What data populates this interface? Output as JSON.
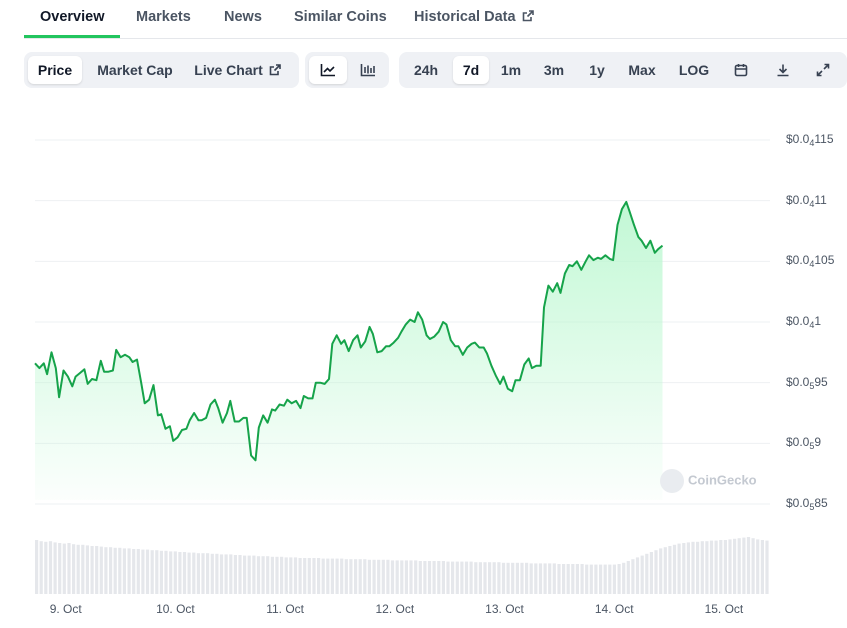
{
  "tabs": [
    {
      "label": "Overview",
      "active": true
    },
    {
      "label": "Markets"
    },
    {
      "label": "News"
    },
    {
      "label": "Similar Coins"
    },
    {
      "label": "Historical Data",
      "icon": "external-link-icon"
    }
  ],
  "toolbar": {
    "metric": {
      "items": [
        "Price",
        "Market Cap",
        "Live Chart"
      ],
      "selected": "Price",
      "live_icon": "external-link-icon"
    },
    "chart_kind": {
      "icons": [
        "line-chart-icon",
        "candlestick-icon"
      ],
      "selected": "line-chart-icon"
    },
    "range": {
      "items": [
        "24h",
        "7d",
        "1m",
        "3m",
        "1y",
        "Max",
        "LOG"
      ],
      "selected": "7d"
    },
    "actions": {
      "icons": [
        "calendar-icon",
        "download-icon",
        "expand-icon"
      ]
    }
  },
  "watermark": "CoinGecko",
  "colors": {
    "line": "#16a34a",
    "fill_top": "#bbf7d0",
    "accent": "#22c55e",
    "volume": "#e5e7eb"
  },
  "chart_data": {
    "type": "area",
    "x_ticks": [
      "9. Oct",
      "10. Oct",
      "11. Oct",
      "12. Oct",
      "13. Oct",
      "14. Oct",
      "15. Oct"
    ],
    "y_ticks": [
      {
        "prefix": "$0.0",
        "sub": "4",
        "suffix": "115"
      },
      {
        "prefix": "$0.0",
        "sub": "4",
        "suffix": "11"
      },
      {
        "prefix": "$0.0",
        "sub": "4",
        "suffix": "105"
      },
      {
        "prefix": "$0.0",
        "sub": "4",
        "suffix": "1"
      },
      {
        "prefix": "$0.0",
        "sub": "5",
        "suffix": "95"
      },
      {
        "prefix": "$0.0",
        "sub": "5",
        "suffix": "9"
      },
      {
        "prefix": "$0.0",
        "sub": "5",
        "suffix": "85"
      }
    ],
    "y_tick_values": [
      1.15e-05,
      1.1e-05,
      1.05e-05,
      1e-05,
      9.5e-06,
      9e-06,
      8.5e-06
    ],
    "y_range": [
      8.5e-06,
      1.15e-05
    ],
    "x_range": [
      8.72,
      15.42
    ],
    "grid": true,
    "legend": "none",
    "price": [
      [
        8.72,
        9.66e-06
      ],
      [
        8.76,
        9.62e-06
      ],
      [
        8.8,
        9.66e-06
      ],
      [
        8.83,
        9.57e-06
      ],
      [
        8.87,
        9.75e-06
      ],
      [
        8.91,
        9.62e-06
      ],
      [
        8.94,
        9.38e-06
      ],
      [
        8.98,
        9.6e-06
      ],
      [
        9.02,
        9.55e-06
      ],
      [
        9.06,
        9.47e-06
      ],
      [
        9.09,
        9.55e-06
      ],
      [
        9.13,
        9.58e-06
      ],
      [
        9.17,
        9.61e-06
      ],
      [
        9.2,
        9.49e-06
      ],
      [
        9.24,
        9.53e-06
      ],
      [
        9.28,
        9.52e-06
      ],
      [
        9.32,
        9.68e-06
      ],
      [
        9.35,
        9.59e-06
      ],
      [
        9.39,
        9.59e-06
      ],
      [
        9.43,
        9.6e-06
      ],
      [
        9.46,
        9.77e-06
      ],
      [
        9.5,
        9.71e-06
      ],
      [
        9.54,
        9.73e-06
      ],
      [
        9.58,
        9.71e-06
      ],
      [
        9.61,
        9.67e-06
      ],
      [
        9.65,
        9.69e-06
      ],
      [
        9.69,
        9.49e-06
      ],
      [
        9.72,
        9.33e-06
      ],
      [
        9.76,
        9.36e-06
      ],
      [
        9.8,
        9.48e-06
      ],
      [
        9.84,
        9.23e-06
      ],
      [
        9.87,
        9.24e-06
      ],
      [
        9.91,
        9.12e-06
      ],
      [
        9.95,
        9.14e-06
      ],
      [
        9.98,
        9.02e-06
      ],
      [
        10.02,
        9.05e-06
      ],
      [
        10.06,
        9.11e-06
      ],
      [
        10.1,
        9.12e-06
      ],
      [
        10.13,
        9.19e-06
      ],
      [
        10.17,
        9.25e-06
      ],
      [
        10.21,
        9.19e-06
      ],
      [
        10.24,
        9.19e-06
      ],
      [
        10.28,
        9.21e-06
      ],
      [
        10.32,
        9.32e-06
      ],
      [
        10.36,
        9.36e-06
      ],
      [
        10.39,
        9.29e-06
      ],
      [
        10.43,
        9.17e-06
      ],
      [
        10.47,
        9.25e-06
      ],
      [
        10.5,
        9.35e-06
      ],
      [
        10.54,
        9.18e-06
      ],
      [
        10.58,
        9.18e-06
      ],
      [
        10.62,
        9.21e-06
      ],
      [
        10.65,
        9.21e-06
      ],
      [
        10.69,
        8.9e-06
      ],
      [
        10.73,
        8.86e-06
      ],
      [
        10.76,
        9.13e-06
      ],
      [
        10.8,
        9.23e-06
      ],
      [
        10.84,
        9.17e-06
      ],
      [
        10.88,
        9.28e-06
      ],
      [
        10.91,
        9.27e-06
      ],
      [
        10.95,
        9.32e-06
      ],
      [
        10.99,
        9.31e-06
      ],
      [
        11.02,
        9.36e-06
      ],
      [
        11.06,
        9.33e-06
      ],
      [
        11.1,
        9.35e-06
      ],
      [
        11.14,
        9.29e-06
      ],
      [
        11.17,
        9.39e-06
      ],
      [
        11.21,
        9.37e-06
      ],
      [
        11.25,
        9.37e-06
      ],
      [
        11.28,
        9.5e-06
      ],
      [
        11.32,
        9.5e-06
      ],
      [
        11.36,
        9.49e-06
      ],
      [
        11.4,
        9.53e-06
      ],
      [
        11.43,
        9.82e-06
      ],
      [
        11.47,
        9.89e-06
      ],
      [
        11.51,
        9.82e-06
      ],
      [
        11.54,
        9.85e-06
      ],
      [
        11.58,
        9.76e-06
      ],
      [
        11.62,
        9.85e-06
      ],
      [
        11.66,
        9.89e-06
      ],
      [
        11.69,
        9.79e-06
      ],
      [
        11.73,
        9.84e-06
      ],
      [
        11.77,
        9.96e-06
      ],
      [
        11.8,
        9.9e-06
      ],
      [
        11.84,
        9.75e-06
      ],
      [
        11.88,
        9.76e-06
      ],
      [
        11.92,
        9.8e-06
      ],
      [
        11.95,
        9.8e-06
      ],
      [
        11.99,
        9.83e-06
      ],
      [
        12.03,
        9.87e-06
      ],
      [
        12.06,
        9.92e-06
      ],
      [
        12.1,
        9.98e-06
      ],
      [
        12.14,
        1.002e-05
      ],
      [
        12.18,
        1e-05
      ],
      [
        12.21,
        1.008e-05
      ],
      [
        12.25,
        1.002e-05
      ],
      [
        12.29,
        9.89e-06
      ],
      [
        12.32,
        9.86e-06
      ],
      [
        12.36,
        9.88e-06
      ],
      [
        12.4,
        9.92e-06
      ],
      [
        12.44,
        1e-05
      ],
      [
        12.47,
        9.98e-06
      ],
      [
        12.51,
        9.85e-06
      ],
      [
        12.55,
        9.8e-06
      ],
      [
        12.58,
        9.8e-06
      ],
      [
        12.62,
        9.73e-06
      ],
      [
        12.66,
        9.79e-06
      ],
      [
        12.7,
        9.82e-06
      ],
      [
        12.73,
        9.83e-06
      ],
      [
        12.77,
        9.79e-06
      ],
      [
        12.81,
        9.79e-06
      ],
      [
        12.84,
        9.74e-06
      ],
      [
        12.88,
        9.64e-06
      ],
      [
        12.92,
        9.56e-06
      ],
      [
        12.96,
        9.49e-06
      ],
      [
        12.99,
        9.55e-06
      ],
      [
        13.03,
        9.45e-06
      ],
      [
        13.07,
        9.43e-06
      ],
      [
        13.1,
        9.52e-06
      ],
      [
        13.14,
        9.52e-06
      ],
      [
        13.18,
        9.65e-06
      ],
      [
        13.22,
        9.7e-06
      ],
      [
        13.25,
        9.62e-06
      ],
      [
        13.29,
        9.64e-06
      ],
      [
        13.33,
        9.64e-06
      ],
      [
        13.36,
        1.012e-05
      ],
      [
        13.4,
        1.03e-05
      ],
      [
        13.44,
        1.025e-05
      ],
      [
        13.48,
        1.032e-05
      ],
      [
        13.51,
        1.024e-05
      ],
      [
        13.55,
        1.04e-05
      ],
      [
        13.59,
        1.047e-05
      ],
      [
        13.62,
        1.046e-05
      ],
      [
        13.66,
        1.05e-05
      ],
      [
        13.7,
        1.043e-05
      ],
      [
        13.74,
        1.05e-05
      ],
      [
        13.77,
        1.055e-05
      ],
      [
        13.81,
        1.051e-05
      ],
      [
        13.85,
        1.053e-05
      ],
      [
        13.88,
        1.052e-05
      ],
      [
        13.92,
        1.055e-05
      ],
      [
        13.96,
        1.052e-05
      ],
      [
        13.99,
        1.051e-05
      ],
      [
        14.03,
        1.08e-05
      ],
      [
        14.07,
        1.093e-05
      ],
      [
        14.11,
        1.099e-05
      ],
      [
        14.14,
        1.091e-05
      ],
      [
        14.18,
        1.08e-05
      ],
      [
        14.22,
        1.07e-05
      ],
      [
        14.25,
        1.067e-05
      ],
      [
        14.29,
        1.061e-05
      ],
      [
        14.33,
        1.067e-05
      ],
      [
        14.37,
        1.057e-05
      ],
      [
        14.4,
        1.06e-05
      ],
      [
        14.44,
        1.063e-05
      ]
    ],
    "volume_rel": [
      0.9,
      0.88,
      0.87,
      0.88,
      0.86,
      0.85,
      0.84,
      0.85,
      0.83,
      0.82,
      0.82,
      0.81,
      0.8,
      0.8,
      0.79,
      0.78,
      0.78,
      0.77,
      0.77,
      0.76,
      0.76,
      0.75,
      0.75,
      0.74,
      0.74,
      0.73,
      0.73,
      0.72,
      0.72,
      0.71,
      0.71,
      0.7,
      0.7,
      0.69,
      0.69,
      0.68,
      0.68,
      0.68,
      0.67,
      0.67,
      0.66,
      0.66,
      0.66,
      0.65,
      0.65,
      0.64,
      0.64,
      0.64,
      0.63,
      0.63,
      0.63,
      0.62,
      0.62,
      0.62,
      0.61,
      0.61,
      0.61,
      0.6,
      0.6,
      0.6,
      0.6,
      0.6,
      0.59,
      0.59,
      0.59,
      0.59,
      0.59,
      0.58,
      0.58,
      0.58,
      0.58,
      0.58,
      0.57,
      0.57,
      0.57,
      0.57,
      0.57,
      0.56,
      0.56,
      0.56,
      0.56,
      0.56,
      0.56,
      0.55,
      0.55,
      0.55,
      0.55,
      0.55,
      0.55,
      0.54,
      0.54,
      0.54,
      0.54,
      0.54,
      0.54,
      0.53,
      0.53,
      0.53,
      0.53,
      0.53,
      0.53,
      0.52,
      0.52,
      0.52,
      0.52,
      0.52,
      0.52,
      0.51,
      0.51,
      0.51,
      0.51,
      0.51,
      0.51,
      0.5,
      0.5,
      0.5,
      0.5,
      0.5,
      0.5,
      0.49,
      0.49,
      0.49,
      0.49,
      0.49,
      0.49,
      0.49,
      0.5,
      0.52,
      0.55,
      0.58,
      0.61,
      0.64,
      0.67,
      0.7,
      0.73,
      0.76,
      0.78,
      0.8,
      0.82,
      0.84,
      0.85,
      0.86,
      0.87,
      0.87,
      0.88,
      0.88,
      0.89,
      0.89,
      0.9,
      0.9,
      0.91,
      0.92,
      0.93,
      0.94,
      0.95,
      0.93,
      0.91,
      0.9,
      0.89
    ]
  }
}
